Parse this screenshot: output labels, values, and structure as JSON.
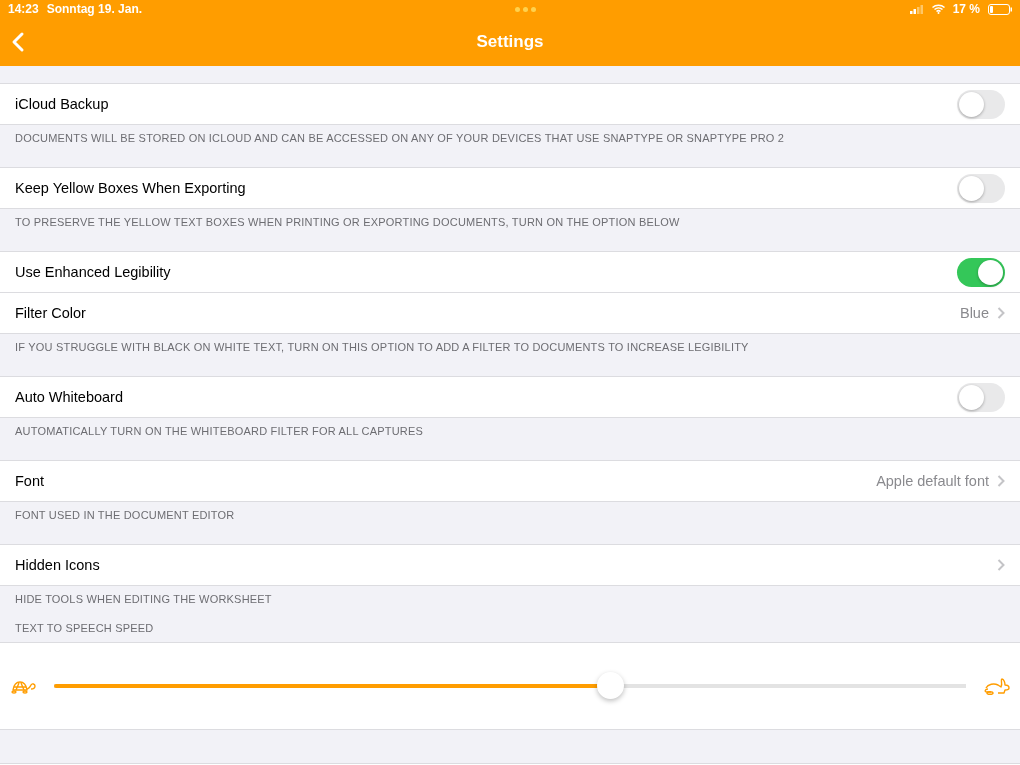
{
  "status_bar": {
    "time": "14:23",
    "date": "Sonntag 19. Jan.",
    "battery_text": "17 %"
  },
  "nav": {
    "title": "Settings"
  },
  "sections": [
    {
      "rows": [
        {
          "kind": "toggle",
          "label": "iCloud Backup",
          "on": false
        }
      ],
      "footer": "DOCUMENTS WILL BE STORED ON ICLOUD AND CAN BE ACCESSED ON ANY OF YOUR DEVICES THAT USE SNAPTYPE OR SNAPTYPE PRO 2"
    },
    {
      "rows": [
        {
          "kind": "toggle",
          "label": "Keep Yellow Boxes When Exporting",
          "on": false
        }
      ],
      "footer": "TO PRESERVE THE YELLOW TEXT BOXES WHEN PRINTING OR EXPORTING DOCUMENTS, TURN ON THE OPTION BELOW"
    },
    {
      "rows": [
        {
          "kind": "toggle",
          "label": "Use Enhanced Legibility",
          "on": true
        },
        {
          "kind": "disclosure",
          "label": "Filter Color",
          "value": "Blue"
        }
      ],
      "footer": "IF YOU STRUGGLE WITH BLACK ON WHITE TEXT, TURN ON THIS OPTION TO ADD A FILTER TO DOCUMENTS TO INCREASE LEGIBILITY"
    },
    {
      "rows": [
        {
          "kind": "toggle",
          "label": "Auto Whiteboard",
          "on": false
        }
      ],
      "footer": "AUTOMATICALLY TURN ON THE WHITEBOARD FILTER FOR ALL CAPTURES"
    },
    {
      "rows": [
        {
          "kind": "disclosure",
          "label": "Font",
          "value": "Apple default font"
        }
      ],
      "footer": "FONT USED IN THE DOCUMENT EDITOR"
    },
    {
      "rows": [
        {
          "kind": "disclosure",
          "label": "Hidden Icons"
        }
      ],
      "footer": "HIDE TOOLS WHEN EDITING THE WORKSHEET"
    }
  ],
  "speech": {
    "header": "TEXT TO SPEECH SPEED",
    "level": 0.61
  }
}
